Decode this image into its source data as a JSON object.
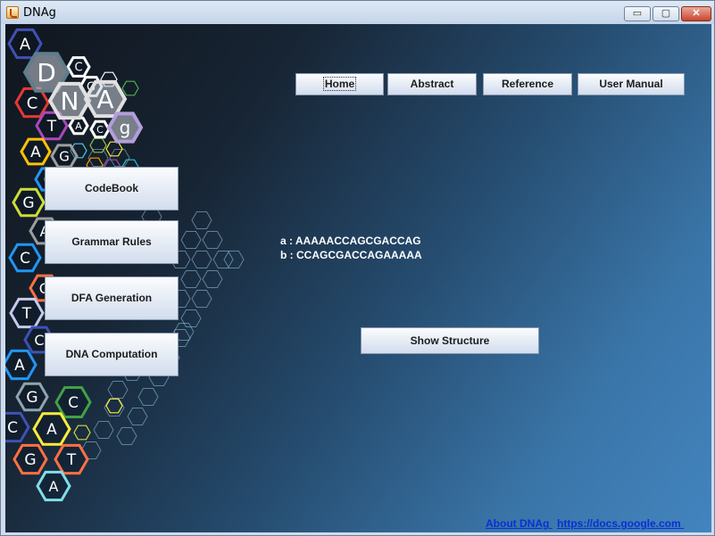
{
  "window": {
    "title": "DNAg",
    "controls": {
      "minimize": "▭",
      "maximize": "▢",
      "close": "✕"
    }
  },
  "nav": {
    "home": "Home",
    "abstract": "Abstract",
    "reference": "Reference",
    "user_manual": "User Manual"
  },
  "sidebar": {
    "codebook": "CodeBook",
    "grammar_rules": "Grammar Rules",
    "dfa_generation": "DFA Generation",
    "dna_computation": "DNA Computation"
  },
  "sequences": {
    "a": "a : AAAAACCAGCGACCAG",
    "b": "b : CCAGCGACCAGAAAAA"
  },
  "actions": {
    "show_structure": "Show Structure"
  },
  "footer": {
    "about": "About DNAg ",
    "docs": "https://docs.google.com "
  },
  "logo": {
    "letters": [
      "D",
      "N",
      "A",
      "g"
    ]
  },
  "decoration": {
    "hex_letters": [
      "A",
      "C",
      "G",
      "T"
    ]
  },
  "colors": {
    "background_dark": "#10161e",
    "background_light": "#4384bf",
    "link": "#0a2fd6"
  }
}
